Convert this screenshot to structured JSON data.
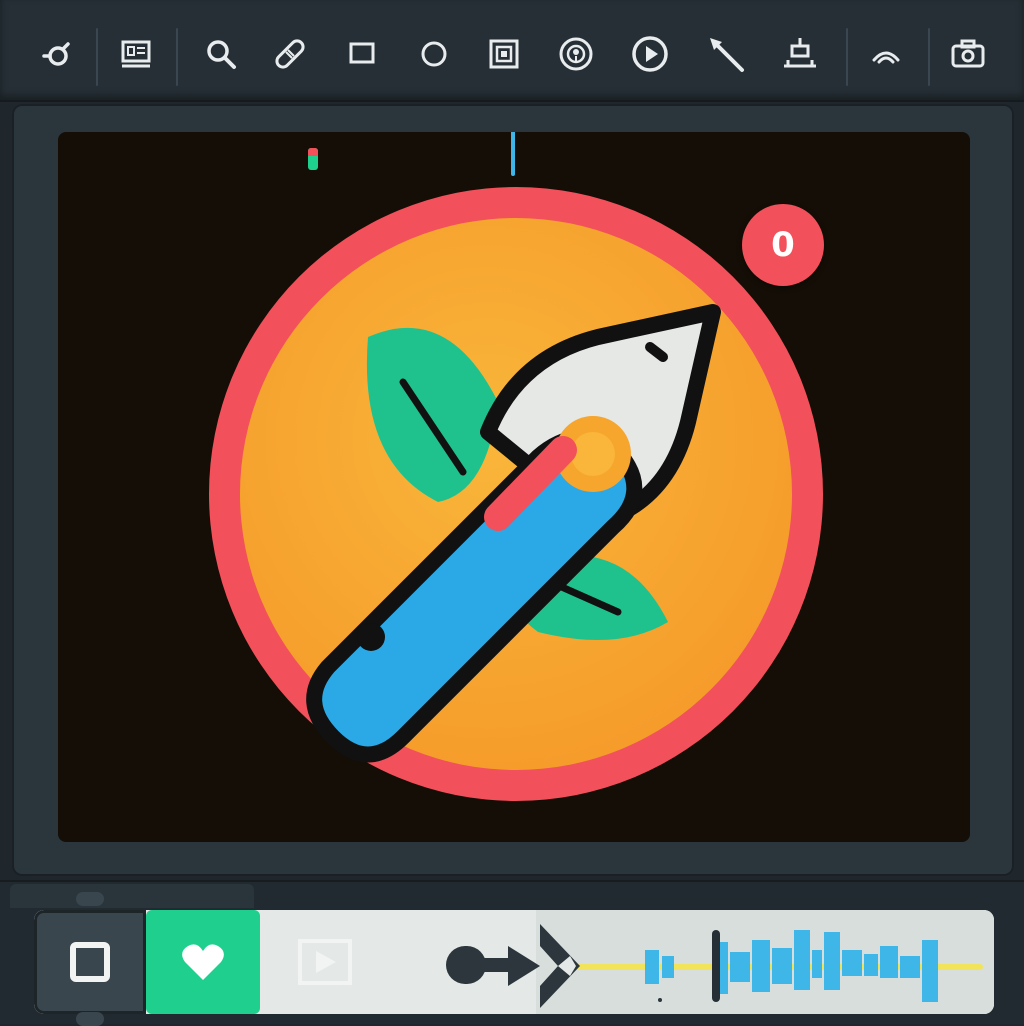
{
  "toolbar": {
    "tools": [
      {
        "name": "pivot-tool-icon"
      },
      {
        "name": "monitor-tool-icon"
      },
      {
        "name": "search-tool-icon"
      },
      {
        "name": "bandage-tool-icon"
      },
      {
        "name": "rectangle-tool-icon"
      },
      {
        "name": "ellipse-tool-icon"
      },
      {
        "name": "frame-tool-icon"
      },
      {
        "name": "target-tool-icon"
      },
      {
        "name": "play-tool-icon"
      },
      {
        "name": "pen-tool-icon"
      },
      {
        "name": "align-tool-icon"
      },
      {
        "name": "signal-tool-icon"
      },
      {
        "name": "camera-tool-icon"
      }
    ]
  },
  "canvas": {
    "badge_count": "0",
    "markers": [
      {
        "name": "timeline-marker-in",
        "color": "#1fcf8e",
        "accent": "#f2505a"
      },
      {
        "name": "timeline-marker-playhead",
        "color": "#3fb6e8"
      }
    ],
    "artwork": {
      "ring_color": "#f2505a",
      "fill_color": "#f6a52d",
      "leaf_color": "#1fc28d",
      "tool_color": "#2aa9e6",
      "tool_accent": "#f2505a",
      "outline_color": "#111111"
    }
  },
  "bottom": {
    "stop_icon": "stop-icon",
    "favorite_icon": "heart-icon",
    "media_icon": "video-frame-icon",
    "scrub_icon": "arrow-handle-icon",
    "waveform_color": "#3fb6e8",
    "progress_line_color": "#f2e45a"
  }
}
